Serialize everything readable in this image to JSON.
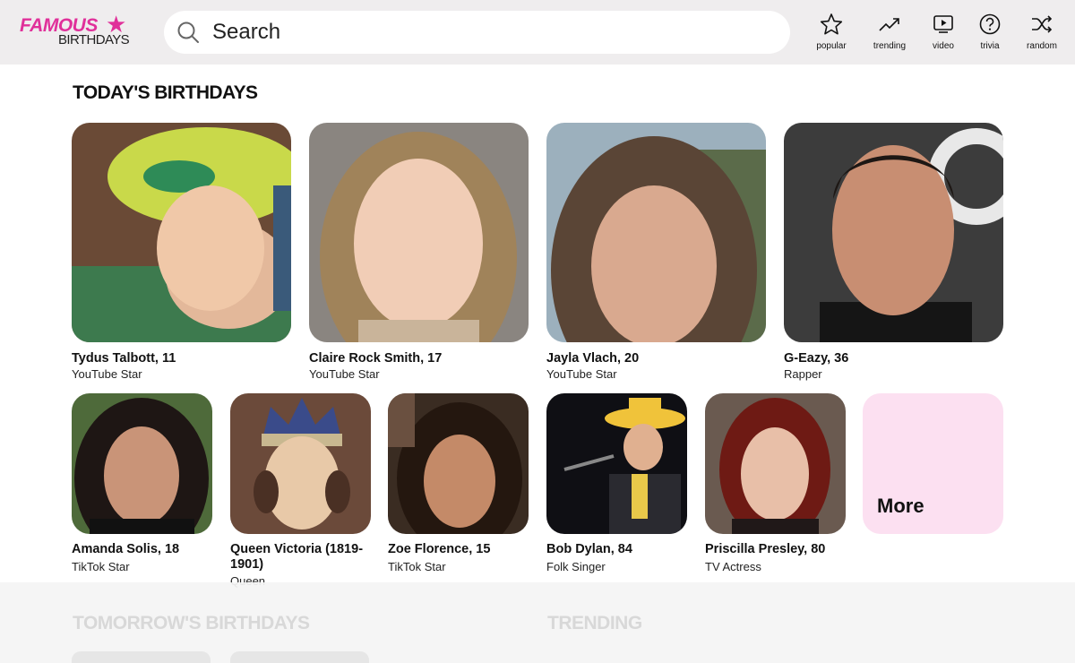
{
  "brand": {
    "logo_line1": "FAMOUS",
    "logo_line2": "BIRTHDAYS",
    "accent": "#e0309a"
  },
  "search": {
    "placeholder": "Search",
    "icon": "search-icon"
  },
  "nav": [
    {
      "label": "popular",
      "icon": "star-icon"
    },
    {
      "label": "trending",
      "icon": "trending-icon"
    },
    {
      "label": "video",
      "icon": "video-icon"
    },
    {
      "label": "trivia",
      "icon": "question-icon"
    },
    {
      "label": "random",
      "icon": "shuffle-icon"
    }
  ],
  "today": {
    "title": "TODAY'S BIRTHDAYS",
    "large": [
      {
        "name": "Tydus Talbott, 11",
        "job": "YouTube Star"
      },
      {
        "name": "Claire Rock Smith, 17",
        "job": "YouTube Star"
      },
      {
        "name": "Jayla Vlach, 20",
        "job": "YouTube Star"
      },
      {
        "name": "G-Eazy, 36",
        "job": "Rapper"
      }
    ],
    "small": [
      {
        "name": "Amanda Solis, 18",
        "job": "TikTok Star"
      },
      {
        "name": "Queen Victoria (1819-1901)",
        "job": "Queen"
      },
      {
        "name": "Zoe Florence, 15",
        "job": "TikTok Star"
      },
      {
        "name": "Bob Dylan, 84",
        "job": "Folk Singer"
      },
      {
        "name": "Priscilla Presley, 80",
        "job": "TV Actress"
      }
    ],
    "more_label": "More"
  },
  "tomorrow": {
    "title": "TOMORROW'S BIRTHDAYS"
  },
  "trending": {
    "title": "TRENDING"
  }
}
